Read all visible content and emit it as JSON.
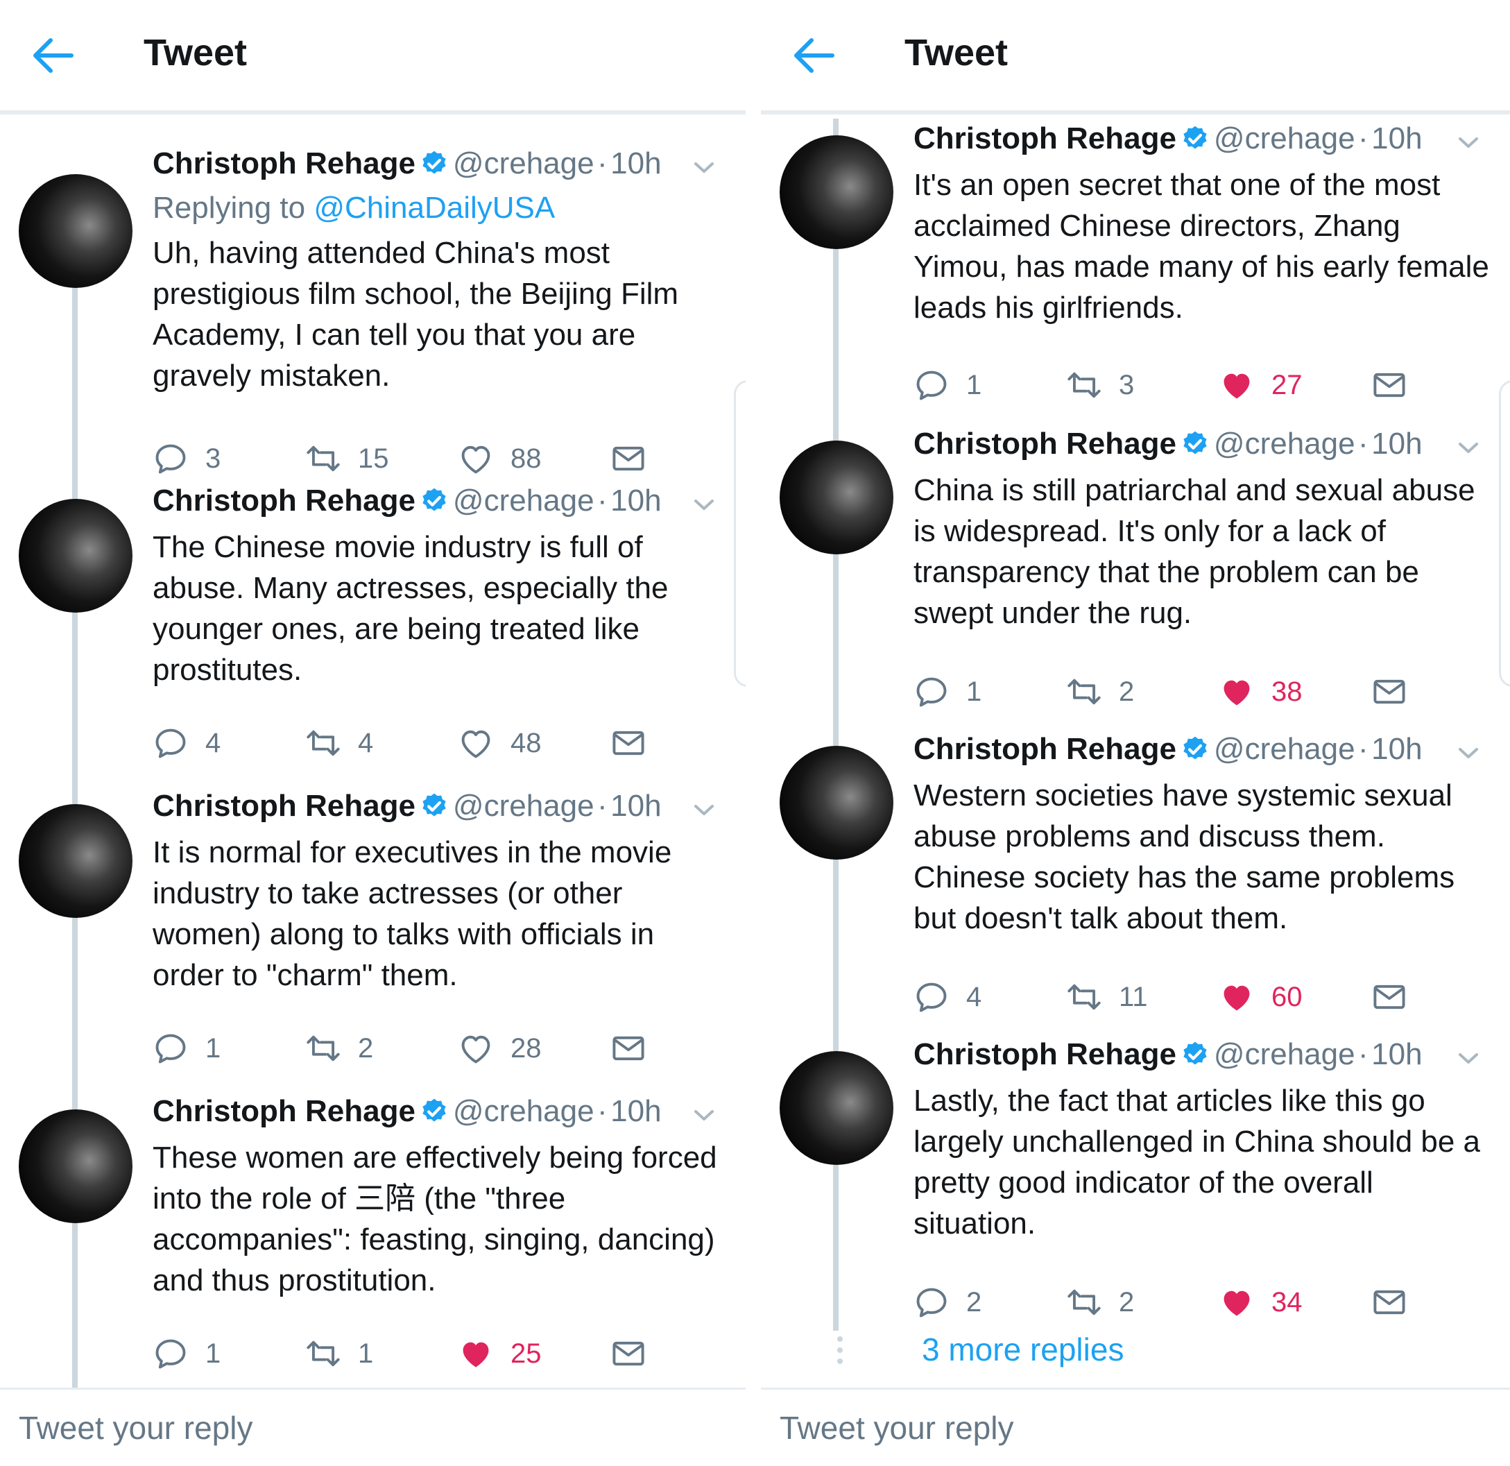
{
  "colors": {
    "accent": "#1da1f2",
    "like": "#e0245e",
    "text": "#14171a",
    "muted": "#657786",
    "line": "#ccd6dd"
  },
  "panels": [
    {
      "header": {
        "title": "Tweet",
        "back_icon": "arrow-left-icon"
      },
      "tweets": [
        {
          "name": "Christoph Rehage",
          "handle": "@crehage",
          "dot": "·",
          "time": "10h",
          "replying_prefix": "Replying to ",
          "replying_to": "@ChinaDailyUSA",
          "text": "Uh, having attended China's most prestigious film school, the Beijing Film Academy, I can tell you that you are gravely mistaken.",
          "replies": "3",
          "retweets": "15",
          "likes": "88",
          "liked": false
        },
        {
          "name": "Christoph Rehage",
          "handle": "@crehage",
          "dot": "·",
          "time": "10h",
          "text": "The Chinese movie industry is full of abuse. Many actresses, especially the younger ones, are being treated like prostitutes.",
          "replies": "4",
          "retweets": "4",
          "likes": "48",
          "liked": false
        },
        {
          "name": "Christoph Rehage",
          "handle": "@crehage",
          "dot": "·",
          "time": "10h",
          "text": "It is normal for executives in the movie industry to take actresses (or other women) along to talks with officials in order to \"charm\" them.",
          "replies": "1",
          "retweets": "2",
          "likes": "28",
          "liked": false
        },
        {
          "name": "Christoph Rehage",
          "handle": "@crehage",
          "dot": "·",
          "time": "10h",
          "text": "These women are effectively being forced into the role of 三陪 (the \"three accompanies\": feasting, singing, dancing) and thus prostitution.",
          "replies": "1",
          "retweets": "1",
          "likes": "25",
          "liked": true
        }
      ],
      "reply_placeholder": "Tweet your reply"
    },
    {
      "header": {
        "title": "Tweet",
        "back_icon": "arrow-left-icon"
      },
      "tweets": [
        {
          "name": "Christoph Rehage",
          "handle": "@crehage",
          "dot": "·",
          "time": "10h",
          "text": "It's an open secret that one of the most acclaimed Chinese directors, Zhang Yimou, has made many of his early female leads his girlfriends.",
          "replies": "1",
          "retweets": "3",
          "likes": "27",
          "liked": true
        },
        {
          "name": "Christoph Rehage",
          "handle": "@crehage",
          "dot": "·",
          "time": "10h",
          "text": "China is still patriarchal and sexual abuse is widespread. It's only for a lack of transparency that the problem can be swept under the rug.",
          "replies": "1",
          "retweets": "2",
          "likes": "38",
          "liked": true
        },
        {
          "name": "Christoph Rehage",
          "handle": "@crehage",
          "dot": "·",
          "time": "10h",
          "text": "Western societies have systemic sexual abuse problems and discuss them. Chinese society has the same problems but doesn't talk about them.",
          "replies": "4",
          "retweets": "11",
          "likes": "60",
          "liked": true
        },
        {
          "name": "Christoph Rehage",
          "handle": "@crehage",
          "dot": "·",
          "time": "10h",
          "text": "Lastly, the fact that articles like this go largely unchallenged in China should be a pretty good indicator of the overall situation.",
          "replies": "2",
          "retweets": "2",
          "likes": "34",
          "liked": true
        }
      ],
      "more_replies": "3 more replies",
      "reply_placeholder": "Tweet your reply"
    }
  ]
}
